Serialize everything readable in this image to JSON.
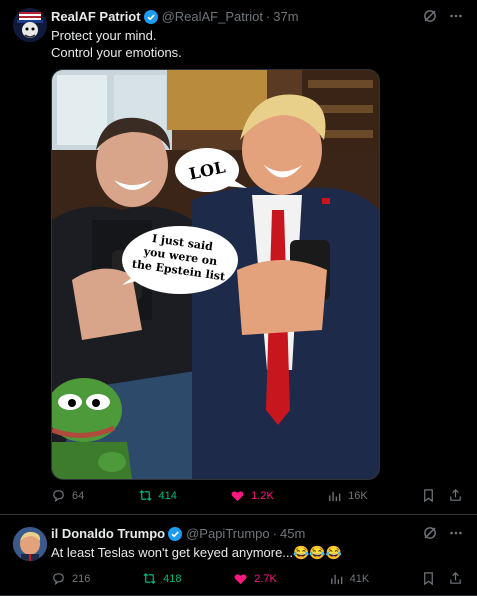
{
  "tweets": [
    {
      "name": "RealAF Patriot",
      "handle": "@RealAF_Patriot",
      "time": "37m",
      "text_lines": [
        "Protect your mind.",
        "Control your emotions."
      ],
      "media": {
        "bubble_lol": "LOL",
        "bubble_epstein": [
          "I just said",
          "you were on",
          "the Epstein list"
        ]
      },
      "actions": {
        "replies": "64",
        "reposts": "414",
        "likes": "1.2K",
        "views": "16K"
      }
    },
    {
      "name": "il Donaldo Trumpo",
      "handle": "@PapiTrumpo",
      "time": "45m",
      "text": "At least Teslas won't get keyed anymore...😂😂😂",
      "actions": {
        "replies": "216",
        "reposts": "418",
        "likes": "2.7K",
        "views": "41K"
      }
    }
  ],
  "colors": {
    "verified": "#1d9bf0",
    "repost": "#00ba7c",
    "like": "#f91880",
    "muted": "#71767b"
  },
  "icons": [
    "grok-icon",
    "more-icon",
    "reply-icon",
    "repost-icon",
    "like-icon",
    "views-icon",
    "bookmark-icon",
    "share-icon"
  ]
}
